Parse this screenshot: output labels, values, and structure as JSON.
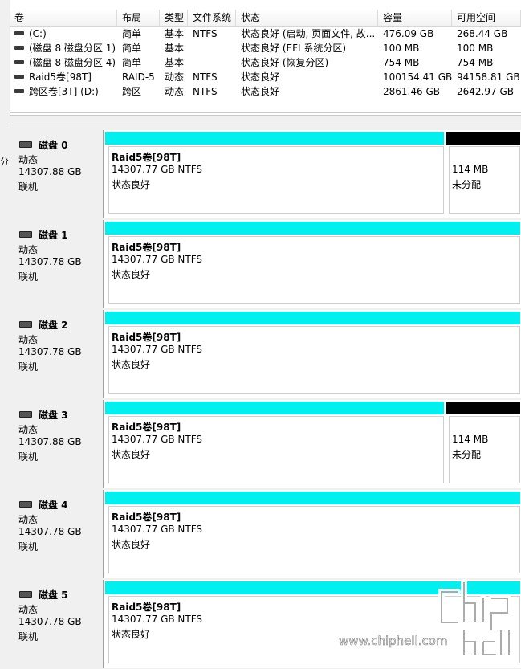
{
  "left_cut": "分",
  "volumes": {
    "columns": [
      "卷",
      "布局",
      "类型",
      "文件系统",
      "状态",
      "容量",
      "可用空间"
    ],
    "rows": [
      {
        "name": "(C:)",
        "layout": "简单",
        "type": "基本",
        "fs": "NTFS",
        "status": "状态良好 (启动, 页面文件, 故...",
        "capacity": "476.09 GB",
        "free": "268.44 GB"
      },
      {
        "name": "(磁盘 8 磁盘分区 1)",
        "layout": "简单",
        "type": "基本",
        "fs": "",
        "status": "状态良好 (EFI 系统分区)",
        "capacity": "100 MB",
        "free": "100 MB"
      },
      {
        "name": "(磁盘 8 磁盘分区 4)",
        "layout": "简单",
        "type": "基本",
        "fs": "",
        "status": "状态良好 (恢复分区)",
        "capacity": "754 MB",
        "free": "754 MB"
      },
      {
        "name": "Raid5卷[98T]",
        "layout": "RAID-5",
        "type": "动态",
        "fs": "NTFS",
        "status": "状态良好",
        "capacity": "100154.41 GB",
        "free": "94158.81 GB"
      },
      {
        "name": "跨区卷[3T] (D:)",
        "layout": "跨区",
        "type": "动态",
        "fs": "NTFS",
        "status": "状态良好",
        "capacity": "2861.46 GB",
        "free": "2642.97 GB"
      }
    ]
  },
  "disks": [
    {
      "name": "磁盘 0",
      "kind": "动态",
      "size": "14307.88 GB",
      "state": "联机",
      "partitions": [
        {
          "title": "Raid5卷[98T]",
          "size": "14307.77 GB NTFS",
          "status": "状态良好",
          "bar": "cyan"
        },
        {
          "title": "",
          "size": "114 MB",
          "status": "未分配",
          "bar": "black"
        }
      ]
    },
    {
      "name": "磁盘 1",
      "kind": "动态",
      "size": "14307.78 GB",
      "state": "联机",
      "partitions": [
        {
          "title": "Raid5卷[98T]",
          "size": "14307.77 GB NTFS",
          "status": "状态良好",
          "bar": "cyan"
        }
      ]
    },
    {
      "name": "磁盘 2",
      "kind": "动态",
      "size": "14307.78 GB",
      "state": "联机",
      "partitions": [
        {
          "title": "Raid5卷[98T]",
          "size": "14307.77 GB NTFS",
          "status": "状态良好",
          "bar": "cyan"
        }
      ]
    },
    {
      "name": "磁盘 3",
      "kind": "动态",
      "size": "14307.88 GB",
      "state": "联机",
      "partitions": [
        {
          "title": "Raid5卷[98T]",
          "size": "14307.77 GB NTFS",
          "status": "状态良好",
          "bar": "cyan"
        },
        {
          "title": "",
          "size": "114 MB",
          "status": "未分配",
          "bar": "black"
        }
      ]
    },
    {
      "name": "磁盘 4",
      "kind": "动态",
      "size": "14307.78 GB",
      "state": "联机",
      "partitions": [
        {
          "title": "Raid5卷[98T]",
          "size": "14307.77 GB NTFS",
          "status": "状态良好",
          "bar": "cyan"
        }
      ]
    },
    {
      "name": "磁盘 5",
      "kind": "动态",
      "size": "14307.78 GB",
      "state": "联机",
      "partitions": [
        {
          "title": "Raid5卷[98T]",
          "size": "14307.77 GB NTFS",
          "status": "状态良好",
          "bar": "cyan"
        }
      ]
    }
  ],
  "watermark": {
    "text": "www.chiphell.com",
    "logo": "chip hell"
  },
  "colors": {
    "raid_bar": "#00f0f0",
    "unallocated_bar": "#000000"
  }
}
